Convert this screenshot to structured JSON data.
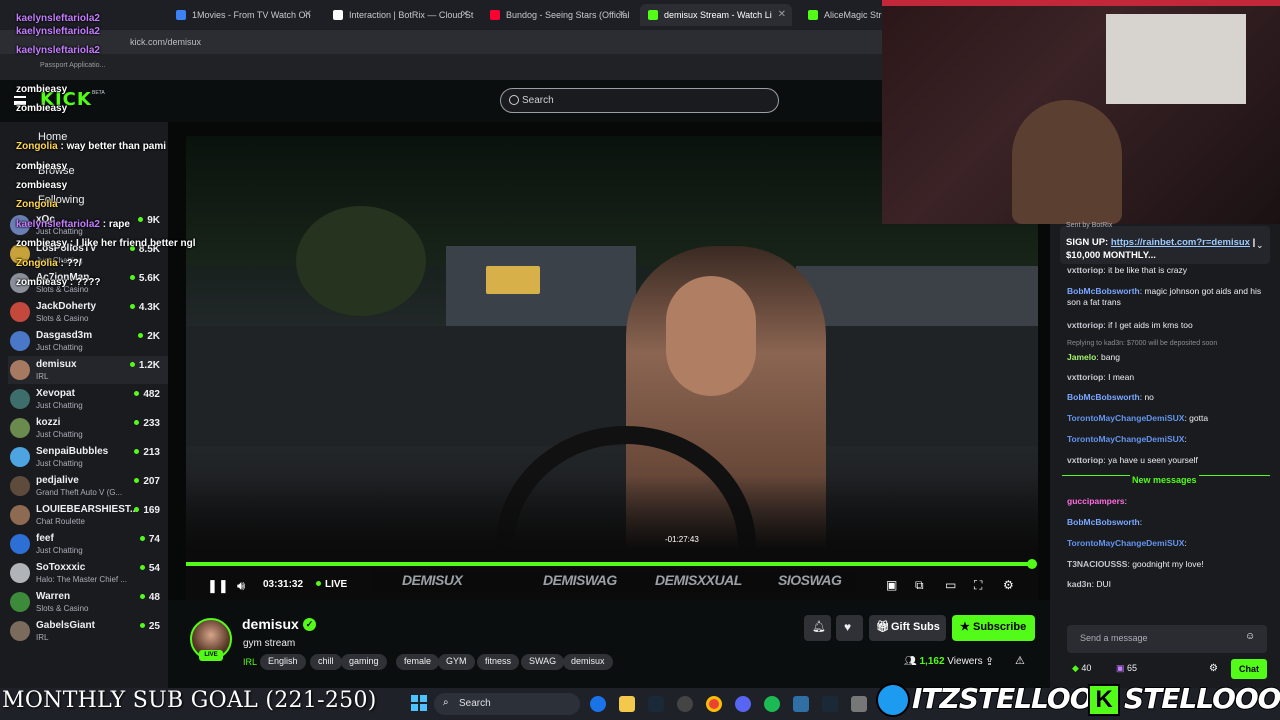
{
  "browser": {
    "tabs": [
      {
        "label": "1Movies - From TV Watch On",
        "color": "#3b82f6"
      },
      {
        "label": "Interaction | BotRix — Cloud St",
        "color": "#ffffff"
      },
      {
        "label": "Bundog - Seeing Stars (Official",
        "color": "#ff0033"
      },
      {
        "label": "demisux Stream - Watch Li",
        "color": "#53fc18",
        "active": true
      },
      {
        "label": "AliceMagic Strea",
        "color": "#53fc18"
      }
    ],
    "url": "kick.com/demisux",
    "bookmark": "Passport Applicatio..."
  },
  "header": {
    "logo": "KICK",
    "beta": "BETA",
    "search_placeholder": "Search"
  },
  "sidebar": {
    "nav": [
      "Home",
      "Browse",
      "Following"
    ],
    "channels": [
      {
        "name": "xQc",
        "category": "Just Chatting",
        "viewers": "9K",
        "color": "#6a7fb5"
      },
      {
        "name": "LosPollosTV",
        "category": "Just Chatting",
        "viewers": "8.5K",
        "color": "#c7a23b"
      },
      {
        "name": "Ac7ionMan",
        "category": "Slots & Casino",
        "viewers": "5.6K",
        "color": "#8a8f99"
      },
      {
        "name": "JackDoherty",
        "category": "Slots & Casino",
        "viewers": "4.3K",
        "color": "#c4493d"
      },
      {
        "name": "Dasgasd3m",
        "category": "Just Chatting",
        "viewers": "2K",
        "color": "#4a77c7"
      },
      {
        "name": "demisux",
        "category": "IRL",
        "viewers": "1.2K",
        "color": "#a57a60",
        "active": true
      },
      {
        "name": "Xevopat",
        "category": "Just Chatting",
        "viewers": "482",
        "color": "#3d6e6b"
      },
      {
        "name": "kozzi",
        "category": "Just Chatting",
        "viewers": "233",
        "color": "#6b8a4d"
      },
      {
        "name": "SenpaiBubbles",
        "category": "Just Chatting",
        "viewers": "213",
        "color": "#4ea4e0"
      },
      {
        "name": "pedjalive",
        "category": "Grand Theft Auto V (G...",
        "viewers": "207",
        "color": "#5f4b3c"
      },
      {
        "name": "LOUIEBEARSHIEST...",
        "category": "Chat Roulette",
        "viewers": "169",
        "color": "#8e6a52"
      },
      {
        "name": "feef",
        "category": "Just Chatting",
        "viewers": "74",
        "color": "#2e6fd6"
      },
      {
        "name": "SoToxxxic",
        "category": "Halo: The Master Chief ...",
        "viewers": "54",
        "color": "#b0b3b8"
      },
      {
        "name": "Warren",
        "category": "Slots & Casino",
        "viewers": "48",
        "color": "#3d8a3a"
      },
      {
        "name": "GabelsGiant",
        "category": "IRL",
        "viewers": "25",
        "color": "#7a6b5d"
      }
    ]
  },
  "player": {
    "progress": 0.998,
    "hover_time": "-01:27:43",
    "elapsed": "03:31:32",
    "live_label": "LIVE",
    "banner": [
      "DEMISUX",
      "DEMISWAG",
      "DEMISXXUAL",
      "SIOSWAG"
    ]
  },
  "stream": {
    "streamer": "demisux",
    "live_badge": "LIVE",
    "title": "gym stream",
    "category": "IRL",
    "tags": [
      "English",
      "chill",
      "gaming",
      "female",
      "GYM",
      "fitness",
      "SWAG",
      "demisux"
    ],
    "gift_label": "Gift Subs",
    "subscribe_label": "Subscribe",
    "viewer_count": "1,162",
    "viewer_label": "Viewers"
  },
  "chat": {
    "pinned_sent_by": "Sent by",
    "pinned_bot": "BotRix",
    "pinned_prefix": "SIGN UP:",
    "pinned_link": "https://rainbet.com?r=demisux",
    "pinned_suffix": "| $10,000 MONTHLY...",
    "messages": [
      {
        "user": "vxttoriop",
        "text": "it be like that is crazy",
        "cls": "u-g"
      },
      {
        "user": "BobMcBobsworth",
        "text": "magic johnson got aids and his son a fat trans",
        "cls": "u-b"
      },
      {
        "user": "vxttoriop",
        "text": "if I get aids im kms too",
        "cls": "u-g"
      },
      {
        "user": "Jamelo",
        "text": "bang",
        "cls": "u-j",
        "reply": "Replying to kad3n: $7000 will be deposited soon"
      },
      {
        "user": "vxttoriop",
        "text": "I mean",
        "cls": "u-g"
      },
      {
        "user": "BobMcBobsworth",
        "text": "no",
        "cls": "u-b"
      },
      {
        "user": "TorontoMayChangeDemiSUX",
        "text": "gotta",
        "cls": "u-t"
      },
      {
        "user": "TorontoMayChangeDemiSUX",
        "text": "",
        "cls": "u-t"
      },
      {
        "user": "vxttoriop",
        "text": "ya have u seen yourself",
        "cls": "u-g"
      },
      {
        "user": "guccipampers",
        "text": "",
        "cls": "u-p"
      },
      {
        "user": "BobMcBobsworth",
        "text": "",
        "cls": "u-b"
      },
      {
        "user": "TorontoMayChangeDemiSUX",
        "text": "",
        "cls": "u-t"
      },
      {
        "user": "T3NACIOUSSS",
        "text": "goodnight my love!",
        "cls": "u-g"
      },
      {
        "user": "kad3n",
        "text": "DUI",
        "cls": "u-g"
      }
    ],
    "new_messages": "New messages",
    "input_placeholder": "Send a message",
    "points_a": "40",
    "points_b": "65",
    "send_label": "Chat"
  },
  "overlay_chat": [
    {
      "user": "kaelynsleftariola2",
      "text": "",
      "cls": "ov-u"
    },
    {
      "user": "kaelynsleftariola2",
      "text": "",
      "cls": "ov-u"
    },
    {
      "user": "kaelynsleftariola2",
      "text": "",
      "cls": "ov-u"
    },
    {
      "user": "zombieasy",
      "text": "",
      "cls": "ov-z"
    },
    {
      "user": "zombieasy",
      "text": "",
      "cls": "ov-z"
    },
    {
      "user": "Zongolia",
      "text": "way better than pami",
      "cls": "ov-y"
    },
    {
      "user": "zombieasy",
      "text": "",
      "cls": "ov-z"
    },
    {
      "user": "zombieasy",
      "text": "",
      "cls": "ov-z"
    },
    {
      "user": "Zongolia",
      "text": "",
      "cls": "ov-y"
    },
    {
      "user": "kaelynsleftariola2",
      "text": "rape",
      "cls": "ov-u"
    },
    {
      "user": "zombieasy",
      "text": "I like her friend better ngl",
      "cls": "ov-z"
    },
    {
      "user": "Zongolia",
      "text": "??/",
      "cls": "ov-y"
    },
    {
      "user": "zombieasy",
      "text": "????",
      "cls": "ov-z"
    }
  ],
  "overlays": {
    "sub_goal": "MONTHLY SUB GOAL (221-250)",
    "twitter": "ITZSTELLOO",
    "kick": "STELLOOO"
  },
  "taskbar": {
    "search": "Search"
  }
}
